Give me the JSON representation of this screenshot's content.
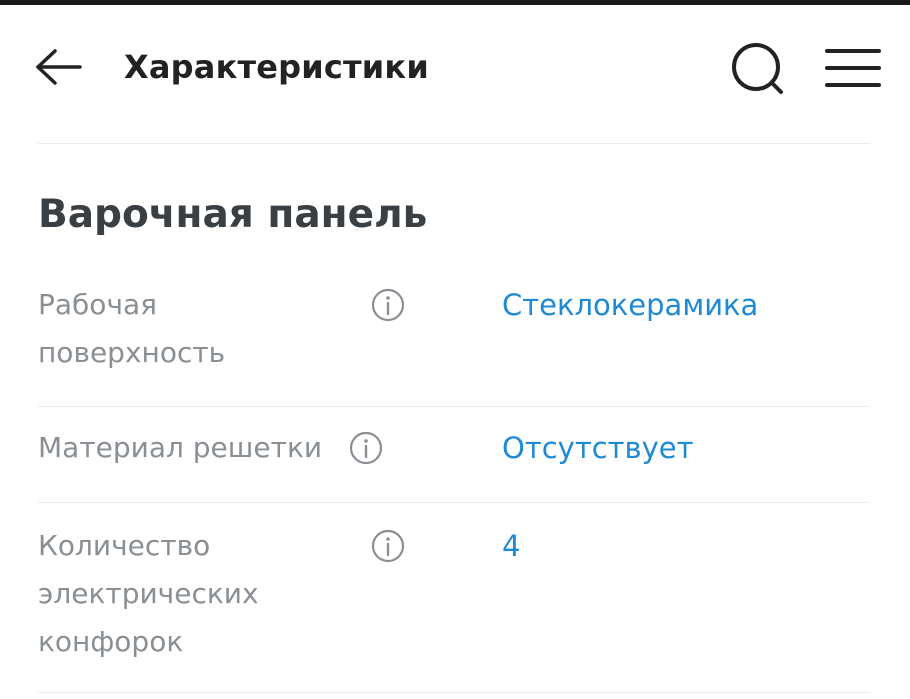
{
  "header": {
    "title": "Характеристики",
    "back_icon": "arrow-left-icon",
    "search_icon": "search-icon",
    "menu_icon": "hamburger-menu-icon"
  },
  "section": {
    "title": "Варочная панель"
  },
  "specs": [
    {
      "label_lines": [
        "Рабочая",
        "поверхность"
      ],
      "value": "Стеклокерамика"
    },
    {
      "label_lines": [
        "Материал решетки"
      ],
      "value": "Отсутствует"
    },
    {
      "label_lines": [
        "Количество",
        "электрических",
        "конфорок"
      ],
      "value": "4"
    }
  ],
  "colors": {
    "title": "#222222",
    "section_title": "#3a3f44",
    "label": "#8a8f94",
    "link": "#1e8ad6",
    "divider": "#ebebeb",
    "icon": "#222222",
    "info_icon": "#8a8f94"
  }
}
